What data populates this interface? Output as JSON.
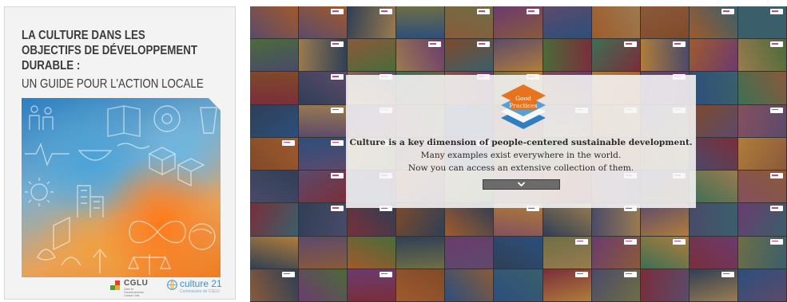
{
  "cover": {
    "title": "LA CULTURE DANS LES\nOBJECTIFS DE DÉVELOPPEMENT\nDURABLE :",
    "subtitle": "UN GUIDE POUR L'ACTION LOCALE",
    "logos": {
      "cglu_name": "CGLU",
      "cglu_tagline": "Cités et Gouvernements Locaux Unis",
      "culture21_name": "culture 21",
      "culture21_tagline": "Commission de CGLU"
    }
  },
  "good_practices": {
    "logo_text": [
      "Good",
      "Practices"
    ],
    "tagline_line1": "Culture is a key dimension of people-centered sustainable development.",
    "tagline_line2": "Many examples exist everywhere in the world.",
    "tagline_line3": "Now you can access an extensive collection of them.",
    "scroll_icon": "chevron-down-icon"
  },
  "colors": {
    "cover_background": "#f3f3f3",
    "cover_text": "#3c3c3c",
    "culture21_blue": "#3f8fd0",
    "logo_orange": "#e8731e",
    "logo_blue": "#2e7fc0",
    "tag_magenta": "#c8478a"
  }
}
